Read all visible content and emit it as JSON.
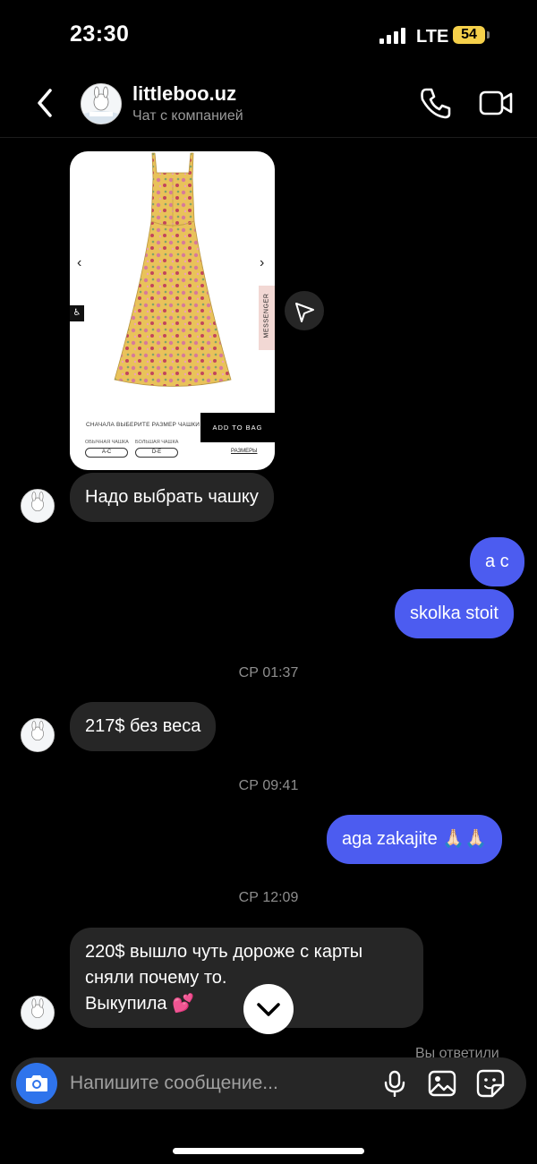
{
  "status_bar": {
    "time": "23:30",
    "network": "LTE",
    "battery": "54"
  },
  "header": {
    "name": "littleboo.uz",
    "subtitle": "Чат с компанией",
    "avatar_text": "LITTLE BOO"
  },
  "product_card": {
    "cup_prompt": "СНАЧАЛА ВЫБЕРИТЕ РАЗМЕР ЧАШКИ",
    "add_to_bag": "ADD TO BAG",
    "side_tab": "MESSENGER",
    "cup_options": [
      {
        "caption": "ОБЫЧНАЯ ЧАШКА",
        "value": "A-C"
      },
      {
        "caption": "БОЛЬШАЯ ЧАШКА",
        "value": "D-E"
      }
    ],
    "sizes_link": "РАЗМЕРЫ",
    "dress_colors": {
      "base": "#e9c25a",
      "flower_pink": "#d77a9a",
      "flower_red": "#c2455c",
      "leaf": "#7fa36a"
    }
  },
  "messages": {
    "m1": "Надо выбрать чашку",
    "m2": "а с",
    "m3": "skolka stoit",
    "t1": "СР 01:37",
    "m4": "217$ без веса",
    "t2": "СР 09:41",
    "m5": "aga zakajite 🙏🏻🙏🏻",
    "t3": "СР 12:09",
    "m6_line1": "220$ вышло чуть дороже с карты",
    "m6_line2": "сняли почему то.",
    "m6_line3": "Выкупила 💕",
    "replied": "Вы ответили"
  },
  "composer": {
    "placeholder": "Напишите сообщение..."
  },
  "colors": {
    "outgoing": "#4c5cf0",
    "incoming": "#262626",
    "camera": "#2f74ec",
    "battery": "#f5d04a"
  }
}
